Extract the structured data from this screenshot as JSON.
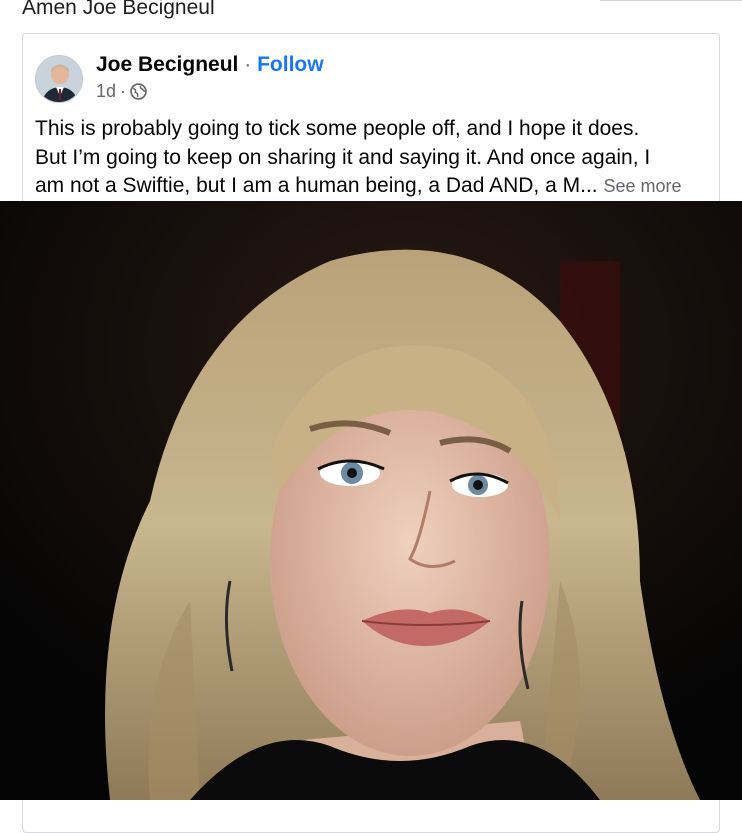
{
  "share": {
    "caption": "Amen Joe Becigneul"
  },
  "post": {
    "author": "Joe Becigneul",
    "separator": "·",
    "follow_label": "Follow",
    "time": "1d",
    "time_separator": "·",
    "privacy_icon": "globe-icon",
    "text_lines": [
      "This is probably going to tick some people off, and I hope it does.",
      "But I’m going to keep on sharing it and saying it. And once again, I",
      "am not a Swiftie, but I am a human being, a Dad AND, a M..."
    ],
    "see_more_label": "See more"
  },
  "colors": {
    "link_blue": "#1877f2",
    "secondary_text": "#65676b",
    "photo_background": "#0a0a0a"
  }
}
